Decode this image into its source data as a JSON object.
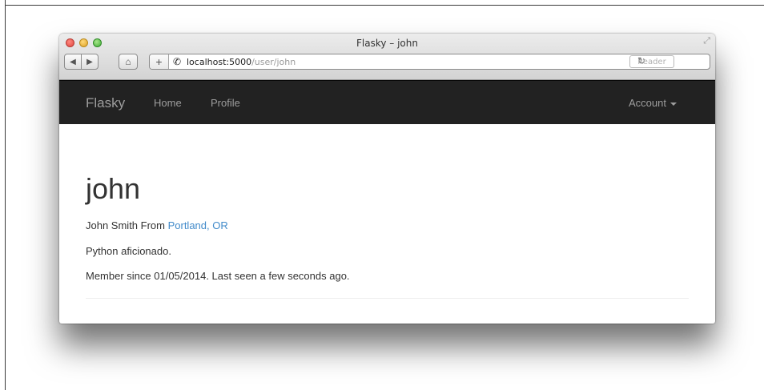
{
  "window": {
    "title": "Flasky – john",
    "address": {
      "host": "localhost:5000",
      "path": "/user/john"
    },
    "reader_label": "Reader"
  },
  "navbar": {
    "brand": "Flasky",
    "links": {
      "home": "Home",
      "profile": "Profile"
    },
    "account": "Account"
  },
  "profile": {
    "username": "john",
    "name_prefix": "John Smith From ",
    "location": "Portland, OR",
    "about": "Python aficionado.",
    "member_info": "Member since 01/05/2014. Last seen a few seconds ago."
  },
  "icons": {
    "back": "back-arrow-icon",
    "forward": "forward-arrow-icon",
    "home": "home-icon",
    "add": "plus-icon",
    "secure": "phone-icon",
    "reload": "reload-icon",
    "download": "download-icon",
    "fullscreen": "fullscreen-icon"
  },
  "colors": {
    "navbar_bg": "#222222",
    "nav_text": "#9d9d9d",
    "link": "#428bca",
    "text": "#333333"
  }
}
